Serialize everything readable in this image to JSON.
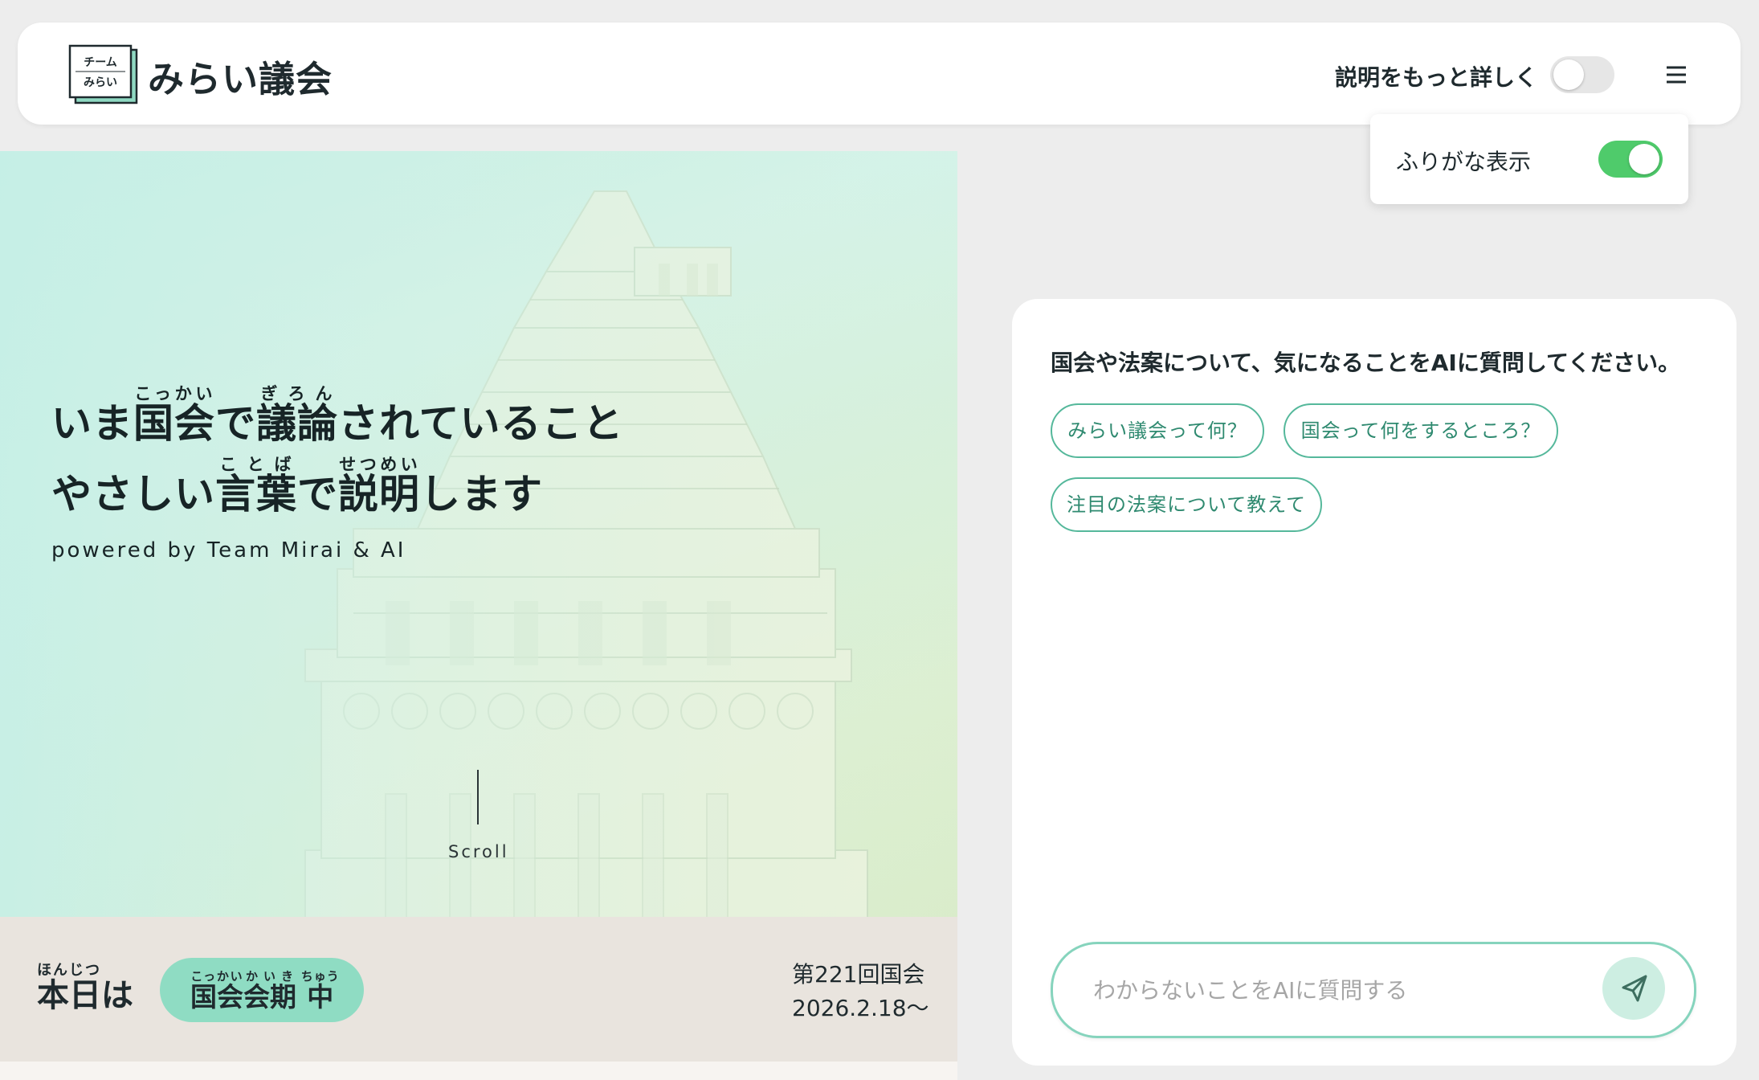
{
  "header": {
    "logo_lines": [
      "チーム",
      "みらい"
    ],
    "title": "みらい議会",
    "detail_toggle_label": "説明をもっと詳しく",
    "detail_toggle_on": false,
    "menu_icon": "hamburger-icon"
  },
  "furigana_menu": {
    "label": "ふりがな表示",
    "enabled": true
  },
  "hero": {
    "line1": [
      {
        "text": "いま"
      },
      {
        "text": "国会",
        "ruby": "こっかい"
      },
      {
        "text": "で"
      },
      {
        "text": "議論",
        "ruby": "ぎろん"
      },
      {
        "text": "されていること"
      }
    ],
    "line2": [
      {
        "text": "やさしい"
      },
      {
        "text": "言葉",
        "ruby": "ことば"
      },
      {
        "text": "で"
      },
      {
        "text": "説明",
        "ruby": "せつめい"
      },
      {
        "text": "します"
      }
    ],
    "powered_by": "powered by Team Mirai & AI",
    "scroll_label": "Scroll"
  },
  "session": {
    "today": {
      "text": "本日",
      "ruby": "ほんじつ",
      "suffix": "は"
    },
    "status": [
      {
        "text": "国会",
        "ruby": "こっかい"
      },
      {
        "text": "会期",
        "ruby": "かいき"
      },
      {
        "text": " "
      },
      {
        "text": "中",
        "ruby": "ちゅう"
      }
    ],
    "diet_number": "第221回国会",
    "start_date": "2026.2.18〜"
  },
  "chat": {
    "prompt": "国会や法案について、気になることをAIに質問してください。",
    "suggestions": [
      "みらい議会って何？",
      "国会って何をするところ？",
      "注目の法案について教えて"
    ],
    "input_placeholder": "わからないことをAIに質問する",
    "send_icon": "paper-plane-icon"
  },
  "colors": {
    "accent": "#55b89b",
    "toggle_on": "#4fcb6b",
    "session_pill": "#8fdcc3"
  }
}
